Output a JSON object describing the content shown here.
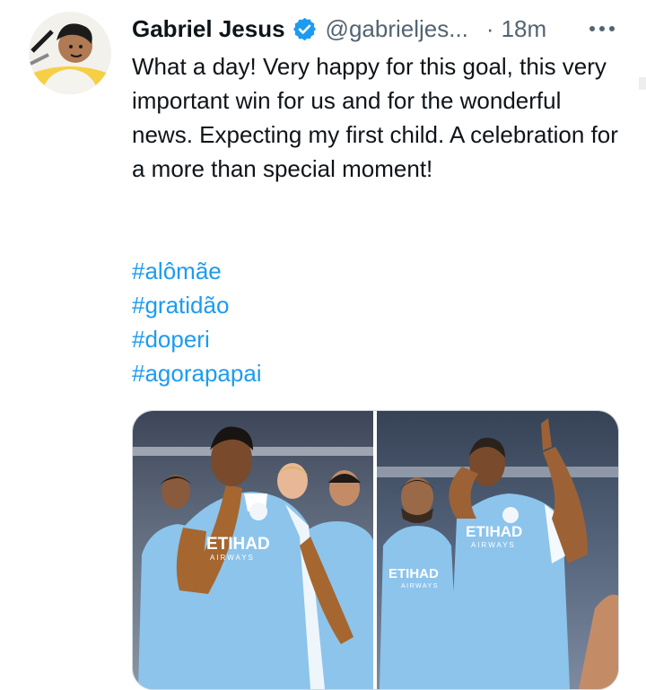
{
  "tweet": {
    "author_name": "Gabriel Jesus",
    "author_handle": "@gabrieljes...",
    "separator": "·",
    "time": "18m",
    "text": "What a day! Very happy for this goal, this very important win for us and for the wonderful news. Expecting my first child. A celebration for a more than special moment!",
    "hashtags": [
      "#alômãe",
      "#gratidão",
      "#doperi",
      "#agorapapai"
    ],
    "photo_labels": [
      {
        "sponsor": "ETIHAD",
        "sub": "AIRWAYS"
      },
      {
        "sponsor": "ETIHAD",
        "sub": "AIRWAYS"
      }
    ]
  },
  "icons": {
    "avatar": "avatar-image",
    "verified": "verified-badge-icon",
    "more": "more-options-icon"
  },
  "colors": {
    "link": "#1d9bf0",
    "verified": "#1d9bf0",
    "secondary_text": "#536471",
    "kit_sky_blue": "#8cc4ec"
  }
}
